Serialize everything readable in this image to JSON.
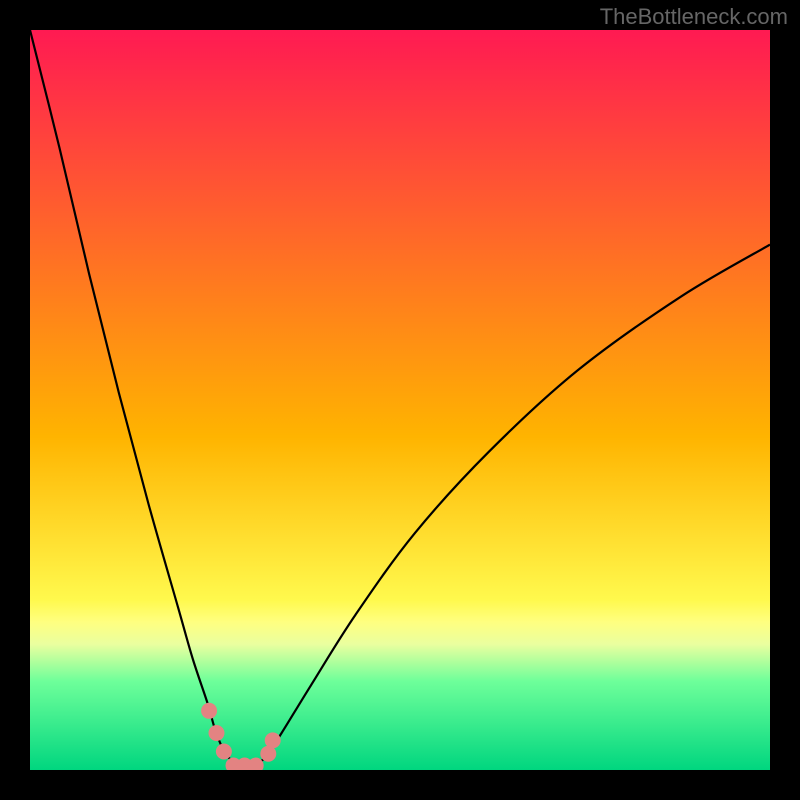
{
  "watermark": "TheBottleneck.com",
  "chart_data": {
    "type": "line",
    "title": "",
    "xlabel": "",
    "ylabel": "",
    "xlim": [
      0,
      100
    ],
    "ylim": [
      0,
      100
    ],
    "background_gradient": {
      "stops": [
        {
          "offset": 0,
          "color": "#ff1a52"
        },
        {
          "offset": 0.55,
          "color": "#ffb400"
        },
        {
          "offset": 0.77,
          "color": "#fff94d"
        },
        {
          "offset": 0.8,
          "color": "#ffff80"
        },
        {
          "offset": 0.83,
          "color": "#eaff9f"
        },
        {
          "offset": 0.88,
          "color": "#6eff9a"
        },
        {
          "offset": 1.0,
          "color": "#00d67f"
        }
      ]
    },
    "series": [
      {
        "name": "bottleneck-curve",
        "x": [
          0,
          4,
          8,
          12,
          16,
          20,
          22,
          24,
          25,
          26,
          27,
          28,
          29,
          30,
          31,
          32,
          34,
          38,
          44,
          52,
          62,
          74,
          88,
          100
        ],
        "values": [
          100,
          84,
          67,
          51,
          36,
          22,
          15,
          9,
          5.5,
          3,
          1.5,
          0.8,
          0.5,
          0.5,
          1.0,
          2.0,
          5,
          11.5,
          21,
          32,
          43,
          54,
          64,
          71
        ]
      }
    ],
    "markers": [
      {
        "x": 24.2,
        "y": 8.0
      },
      {
        "x": 25.2,
        "y": 5.0
      },
      {
        "x": 26.2,
        "y": 2.5
      },
      {
        "x": 27.5,
        "y": 0.6
      },
      {
        "x": 29.0,
        "y": 0.6
      },
      {
        "x": 30.5,
        "y": 0.6
      },
      {
        "x": 32.2,
        "y": 2.2
      },
      {
        "x": 32.8,
        "y": 4.0
      }
    ],
    "marker_radius": 8,
    "marker_color": "#e38382",
    "curve_color": "#000000",
    "curve_width": 2.2
  }
}
